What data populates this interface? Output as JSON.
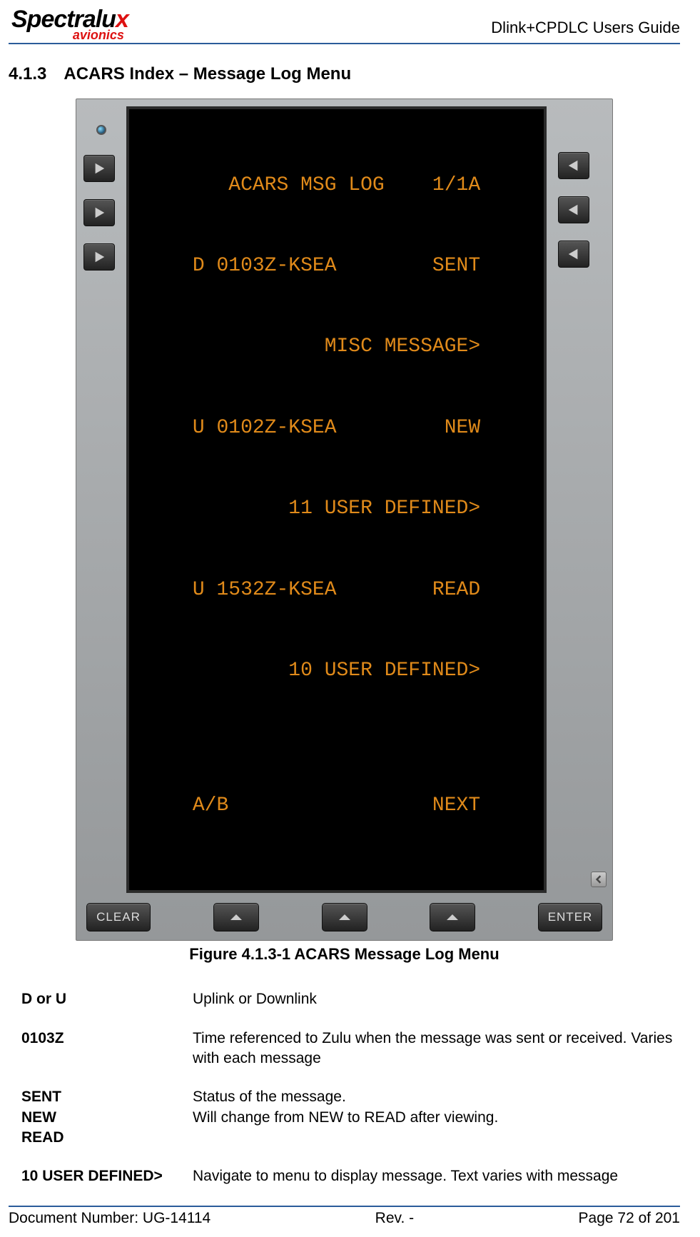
{
  "header": {
    "logo_main": "Spectralu",
    "logo_x": "x",
    "logo_sub": "avionics",
    "doc_title": "Dlink+CPDLC Users Guide"
  },
  "section": {
    "number": "4.1.3",
    "title": "ACARS Index – Message Log Menu"
  },
  "cdu": {
    "screen_lines": [
      "   ACARS MSG LOG    1/1A",
      "D 0103Z-KSEA        SENT",
      "           MISC MESSAGE>",
      "U 0102Z-KSEA         NEW",
      "        11 USER DEFINED>",
      "U 1532Z-KSEA        READ",
      "        10 USER DEFINED>",
      "",
      "A/B                 NEXT"
    ],
    "clear_label": "CLEAR",
    "enter_label": "ENTER"
  },
  "figure_caption": "Figure 4.1.3-1 ACARS Message Log Menu",
  "definitions": [
    {
      "term": "D or U",
      "desc": "Uplink or Downlink"
    },
    {
      "term": "0103Z",
      "desc": "Time referenced to Zulu when the message was sent or received. Varies with each message"
    },
    {
      "term": "SENT\nNEW\nREAD",
      "desc": "Status of the message.\nWill change from NEW to READ after viewing."
    },
    {
      "term": "10 USER DEFINED>",
      "desc": "Navigate to menu to display message.  Text varies with message"
    }
  ],
  "footer": {
    "doc_number": "Document Number:  UG-14114",
    "rev": "Rev. -",
    "page": "Page 72 of 201"
  }
}
